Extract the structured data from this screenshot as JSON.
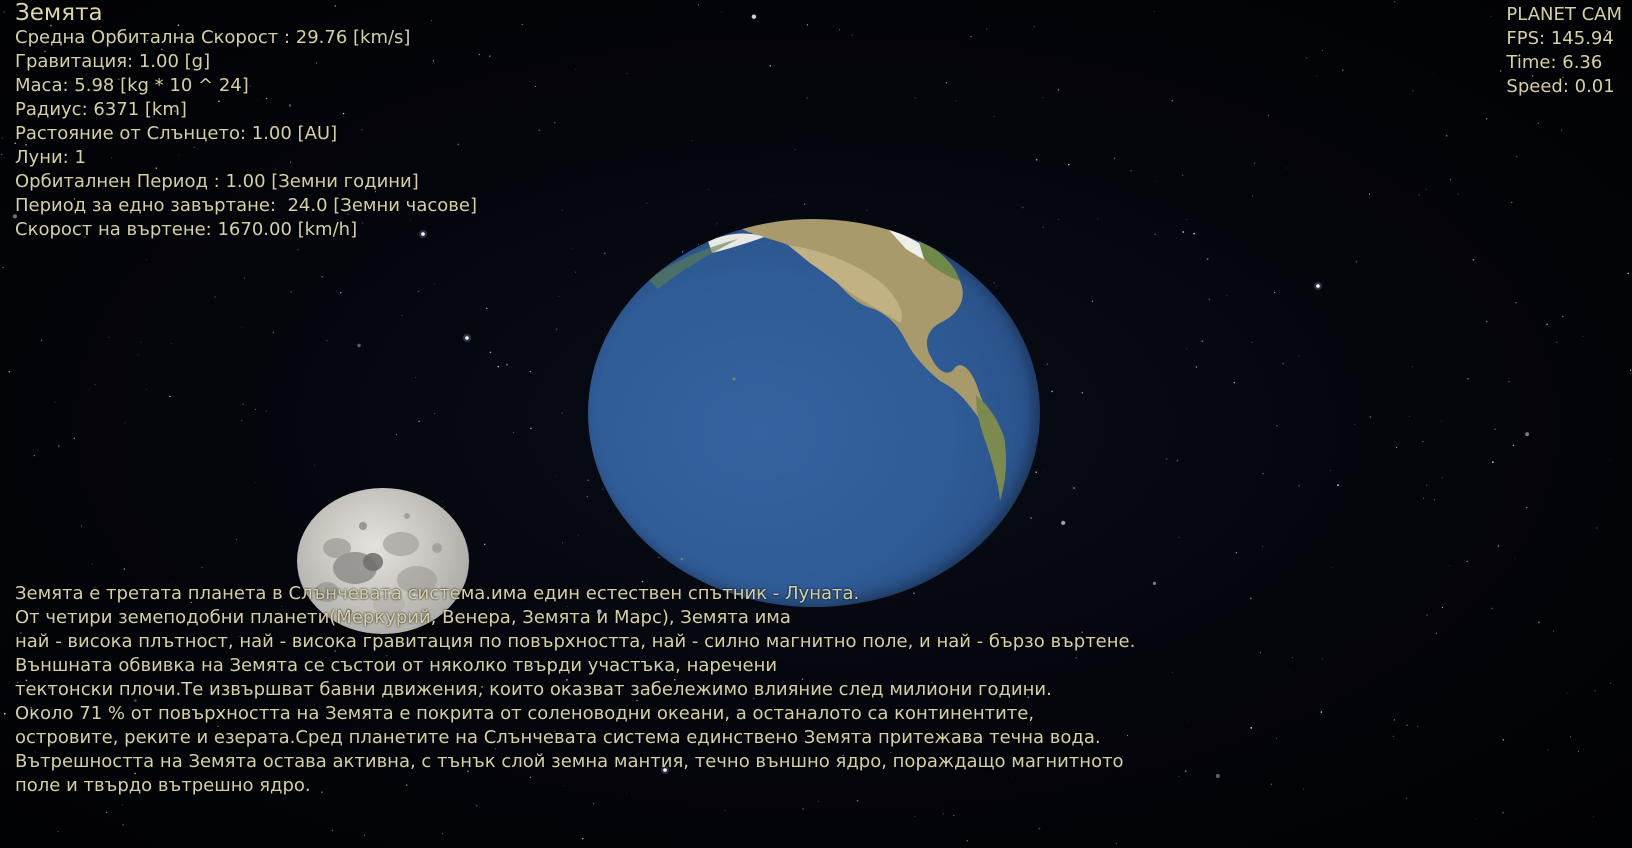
{
  "planet": {
    "name": "Земята",
    "stats": [
      "Средна Орбитална Скорост : 29.76 [km/s]",
      "Гравитация: 1.00 [g]",
      "Маса: 5.98 [kg * 10 ^ 24]",
      "Радиус: 6371 [km]",
      "Растояние от Слънцето: 1.00 [AU]",
      "Луни: 1",
      "Орбиталнен Период : 1.00 [Земни години]",
      "Период за едно завъртане:  24.0 [Земни часове]",
      "Скорост на въртене: 1670.00 [km/h]"
    ]
  },
  "camera": {
    "mode": "PLANET CAM",
    "fps": "FPS: 145.94",
    "time": "Time: 6.36",
    "speed": "Speed: 0.01"
  },
  "description": [
    "Земята е третата планета в Слънчевата система.има един естествен спътник - Луната.",
    "От четири земеподобни планети(Меркурий, Венера, Земята и Марс), Земята има",
    "най - висока плътност, най - висока гравитация по повърхността, най - силно магнитно поле, и най - бързо въртене.",
    "Външната обвивка на Земята се състои от няколко твърди участъка, наречени",
    "тектонски плочи.Те извършват бавни движения, които оказват забележимо влияние след милиони години.",
    "Около 71 % от повърхността на Земята е покрита от соленоводни океани, а останалото са континентите,",
    "островите, реките и езерата.Сред планетите на Слънчевата система единствено Земята притежава течна вода.",
    "Вътрешността на Земята остава активна, с тънък слой земна мантия, течно външно ядро, пораждащо магнитното",
    "поле и твърдо вътрешно ядро."
  ],
  "colors": {
    "hud_text": "#d6d0a2",
    "space": "#020308",
    "ocean": "#2f5b96",
    "land": "#a89a6a",
    "moon": "#c9c7c0"
  }
}
